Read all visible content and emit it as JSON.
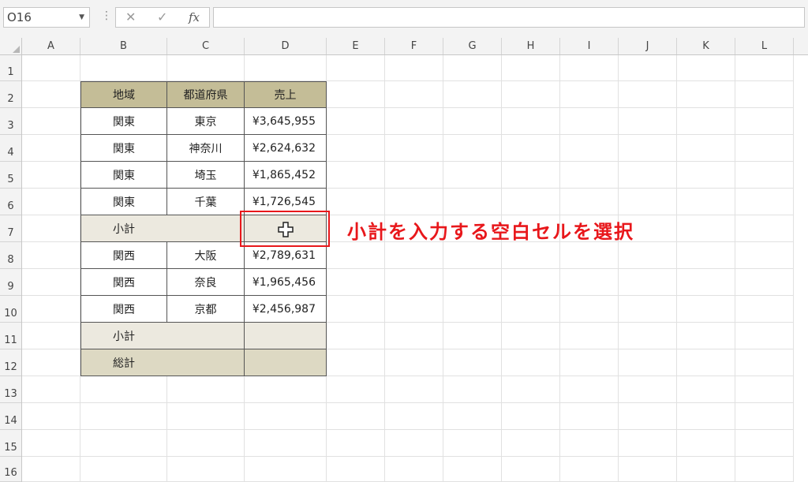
{
  "formula_bar": {
    "name_box": "O16",
    "cancel_icon": "✕",
    "enter_icon": "✓",
    "fx_label": "fx",
    "formula": ""
  },
  "columns": [
    "A",
    "B",
    "C",
    "D",
    "E",
    "F",
    "G",
    "H",
    "I",
    "J",
    "K",
    "L"
  ],
  "rows": [
    "1",
    "2",
    "3",
    "4",
    "5",
    "6",
    "7",
    "8",
    "9",
    "10",
    "11",
    "12",
    "13",
    "14",
    "15",
    "16"
  ],
  "table": {
    "headers": [
      "地域",
      "都道府県",
      "売上"
    ],
    "body": [
      [
        "関東",
        "東京",
        "¥3,645,955"
      ],
      [
        "関東",
        "神奈川",
        "¥2,624,632"
      ],
      [
        "関東",
        "埼玉",
        "¥1,865,452"
      ],
      [
        "関東",
        "千葉",
        "¥1,726,545"
      ],
      [
        "小計",
        "",
        ""
      ],
      [
        "関西",
        "大阪",
        "¥2,789,631"
      ],
      [
        "関西",
        "奈良",
        "¥1,965,456"
      ],
      [
        "関西",
        "京都",
        "¥2,456,987"
      ],
      [
        "小計",
        "",
        ""
      ],
      [
        "総計",
        "",
        ""
      ]
    ]
  },
  "annotation": "小計を入力する空白セルを選択",
  "colors": {
    "header_fill": "#c4bd97",
    "subtotal_fill": "#ece9df",
    "total_fill": "#ddd9c3",
    "annotation_red": "#e8171b"
  }
}
